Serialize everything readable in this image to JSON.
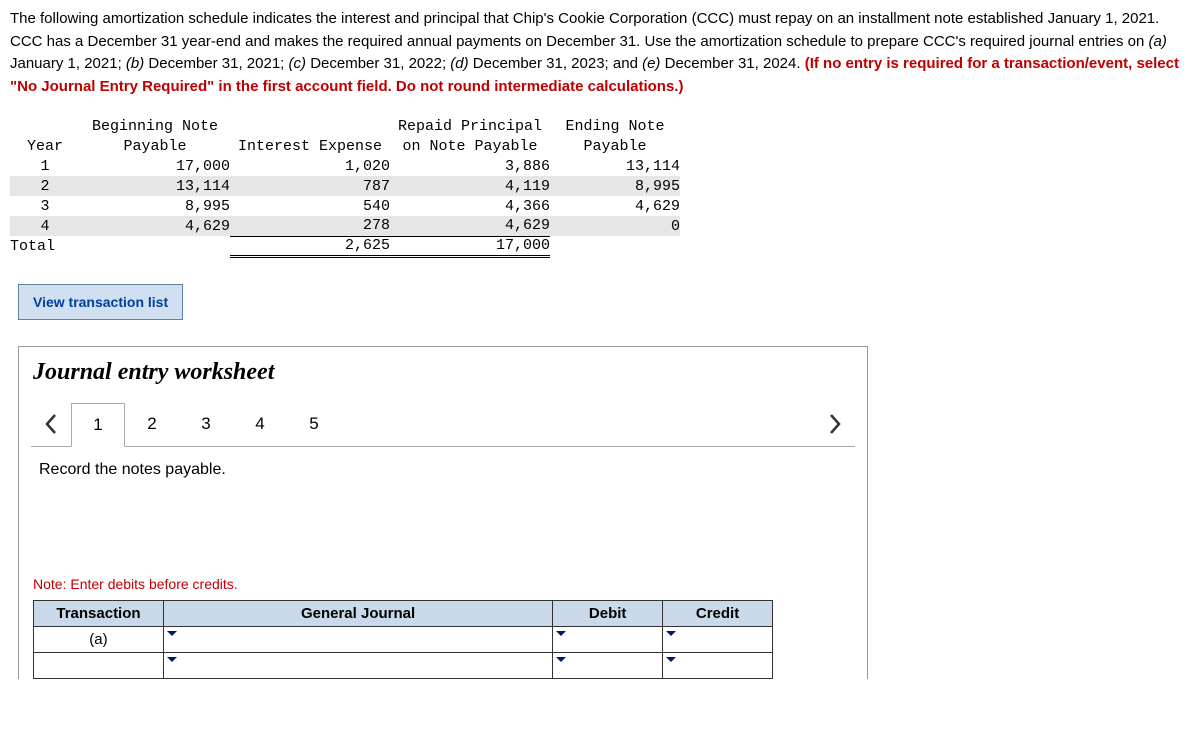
{
  "intro": {
    "p1": "The following amortization schedule indicates the interest and principal that Chip's Cookie Corporation (CCC) must repay on an installment note established January 1, 2021. CCC has a December 31 year-end and makes the required annual payments on December 31. Use the amortization schedule to prepare CCC's required journal entries on ",
    "a": "(a)",
    "a_after": " January 1, 2021; ",
    "b": "(b)",
    "b_after": " December 31, 2021; ",
    "c": "(c)",
    "c_after": " December 31, 2022; ",
    "d": "(d)",
    "d_after": " December 31, 2023; and ",
    "e": "(e)",
    "e_after": " December 31, 2024. ",
    "red": "(If no entry is required for a transaction/event, select \"No Journal Entry Required\" in the first account field. Do not round intermediate calculations.)"
  },
  "amort": {
    "headers": {
      "year": "Year",
      "beg1": "Beginning Note",
      "beg2": "Payable",
      "int": "Interest Expense",
      "rep1": "Repaid Principal",
      "rep2": "on Note Payable",
      "end1": "Ending Note",
      "end2": "Payable"
    },
    "rows": [
      {
        "year": "1",
        "beg": "17,000",
        "int": "1,020",
        "rep": "3,886",
        "end": "13,114",
        "shade": false
      },
      {
        "year": "2",
        "beg": "13,114",
        "int": "787",
        "rep": "4,119",
        "end": "8,995",
        "shade": true
      },
      {
        "year": "3",
        "beg": "8,995",
        "int": "540",
        "rep": "4,366",
        "end": "4,629",
        "shade": false
      },
      {
        "year": "4",
        "beg": "4,629",
        "int": "278",
        "rep": "4,629",
        "end": "0",
        "shade": true
      }
    ],
    "total": {
      "label": "Total",
      "int": "2,625",
      "rep": "17,000"
    }
  },
  "view_transaction_list": "View transaction list",
  "worksheet": {
    "title": "Journal entry worksheet",
    "tabs": [
      "1",
      "2",
      "3",
      "4",
      "5"
    ],
    "active_tab": 0,
    "instruction": "Record the notes payable.",
    "note": "Note: Enter debits before credits.",
    "columns": {
      "transaction": "Transaction",
      "gj": "General Journal",
      "debit": "Debit",
      "credit": "Credit"
    },
    "rows": [
      {
        "trans": "(a)",
        "gj": "",
        "debit": "",
        "credit": ""
      },
      {
        "trans": "",
        "gj": "",
        "debit": "",
        "credit": ""
      }
    ]
  },
  "chart_data": {
    "type": "table",
    "title": "Amortization Schedule",
    "columns": [
      "Year",
      "Beginning Note Payable",
      "Interest Expense",
      "Repaid Principal on Note Payable",
      "Ending Note Payable"
    ],
    "rows": [
      [
        1,
        17000,
        1020,
        3886,
        13114
      ],
      [
        2,
        13114,
        787,
        4119,
        8995
      ],
      [
        3,
        8995,
        540,
        4366,
        4629
      ],
      [
        4,
        4629,
        278,
        4629,
        0
      ]
    ],
    "totals": {
      "Interest Expense": 2625,
      "Repaid Principal on Note Payable": 17000
    }
  }
}
